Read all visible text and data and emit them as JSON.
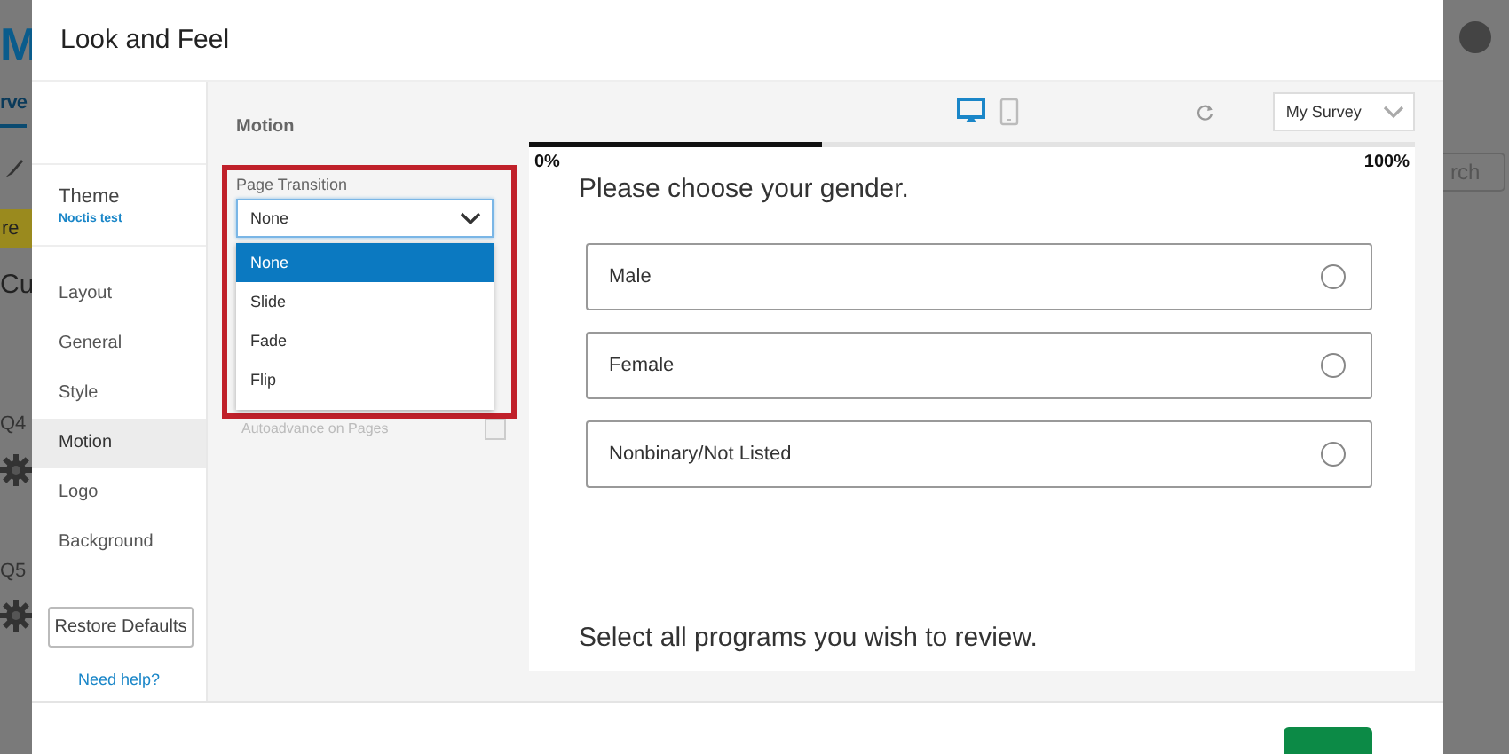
{
  "background_page": {
    "fragments": [
      {
        "kind": "logo",
        "text": "M"
      },
      {
        "kind": "tab",
        "text": "rve"
      },
      {
        "kind": "banner",
        "text": "re"
      },
      {
        "kind": "heading",
        "text": "Cu"
      },
      {
        "kind": "q4",
        "text": "Q4"
      },
      {
        "kind": "q5",
        "text": "Q5"
      },
      {
        "kind": "search",
        "text": "rch"
      }
    ]
  },
  "modal": {
    "title": "Look and Feel"
  },
  "sidebar": {
    "theme": {
      "label": "Theme",
      "value": "Noctis test"
    },
    "items": [
      {
        "label": "Layout",
        "selected": false
      },
      {
        "label": "General",
        "selected": false
      },
      {
        "label": "Style",
        "selected": false
      },
      {
        "label": "Motion",
        "selected": true
      },
      {
        "label": "Logo",
        "selected": false
      },
      {
        "label": "Background",
        "selected": false
      }
    ],
    "restore_button": "Restore Defaults",
    "help_link": "Need help?"
  },
  "settings": {
    "heading": "Motion",
    "page_transition": {
      "label": "Page Transition",
      "value": "None",
      "expanded": true,
      "options": [
        {
          "label": "None",
          "selected": true
        },
        {
          "label": "Slide",
          "selected": false
        },
        {
          "label": "Fade",
          "selected": false
        },
        {
          "label": "Flip",
          "selected": false
        }
      ]
    },
    "autoadvance": {
      "label": "Autoadvance on Pages",
      "checked": false,
      "disabled": true
    }
  },
  "preview": {
    "devices": [
      {
        "kind": "desktop",
        "selected": true
      },
      {
        "kind": "mobile",
        "selected": false
      }
    ],
    "survey_select": "My Survey",
    "progress": {
      "level": 0.33,
      "start_label": "0%",
      "end_label": "100%"
    },
    "question": "Please choose your gender.",
    "choices": [
      {
        "label": "Male",
        "selected": false
      },
      {
        "label": "Female",
        "selected": false
      },
      {
        "label": "Nonbinary/Not Listed",
        "selected": false
      }
    ],
    "next_question": "Select all programs you wish to review."
  }
}
